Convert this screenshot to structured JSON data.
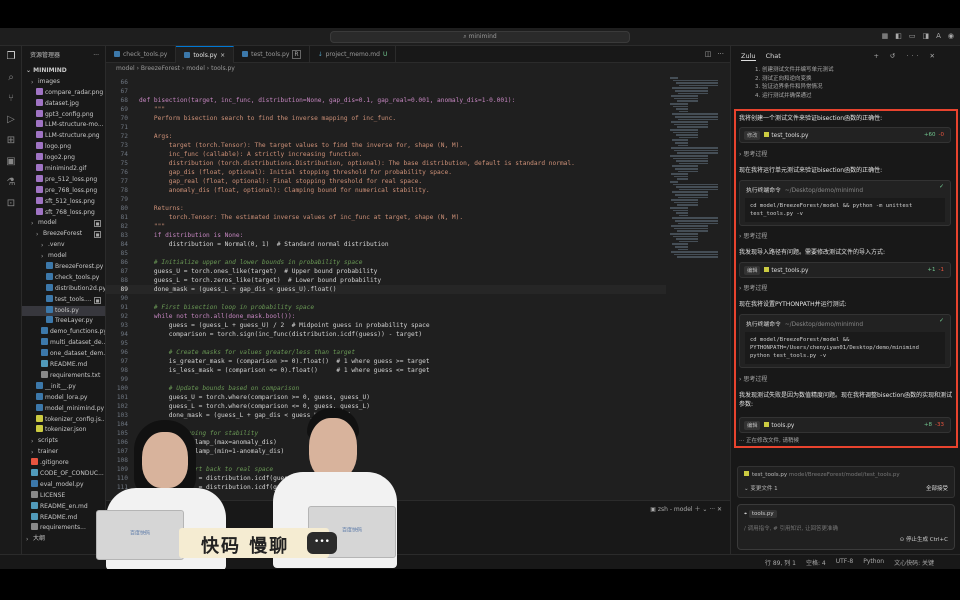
{
  "window": {
    "search_text": "minimind"
  },
  "sidebar": {
    "title": "资源管理器",
    "root": "MINIMIND",
    "rows": [
      {
        "label": "images",
        "kind": "folder"
      },
      {
        "label": "compare_radar.png",
        "kind": "img"
      },
      {
        "label": "dataset.jpg",
        "kind": "img"
      },
      {
        "label": "gpt3_config.png",
        "kind": "img"
      },
      {
        "label": "LLM-structure-mo...",
        "kind": "img"
      },
      {
        "label": "LLM-structure.png",
        "kind": "img"
      },
      {
        "label": "logo.png",
        "kind": "img"
      },
      {
        "label": "logo2.png",
        "kind": "img"
      },
      {
        "label": "minimind2.gif",
        "kind": "img"
      },
      {
        "label": "pre_512_loss.png",
        "kind": "img"
      },
      {
        "label": "pre_768_loss.png",
        "kind": "img"
      },
      {
        "label": "sft_512_loss.png",
        "kind": "img"
      },
      {
        "label": "sft_768_loss.png",
        "kind": "img"
      },
      {
        "label": "model",
        "kind": "folder"
      },
      {
        "label": "BreezeForest",
        "kind": "folder"
      },
      {
        "label": ".venv",
        "kind": "folder"
      },
      {
        "label": "model",
        "kind": "folder"
      },
      {
        "label": "BreezeForest.py",
        "kind": "py"
      },
      {
        "label": "check_tools.py",
        "kind": "py"
      },
      {
        "label": "distribution2d.py",
        "kind": "py"
      },
      {
        "label": "test_tools....",
        "kind": "py"
      },
      {
        "label": "tools.py",
        "kind": "py"
      },
      {
        "label": "TreeLayer.py",
        "kind": "py"
      },
      {
        "label": "demo_functions.py",
        "kind": "py"
      },
      {
        "label": "multi_dataset_de...",
        "kind": "py"
      },
      {
        "label": "one_dataset_dem...",
        "kind": "py"
      },
      {
        "label": "README.md",
        "kind": "md"
      },
      {
        "label": "requirements.txt",
        "kind": "txt"
      },
      {
        "label": "__init__.py",
        "kind": "py"
      },
      {
        "label": "model_lora.py",
        "kind": "py"
      },
      {
        "label": "model_minimind.py",
        "kind": "py"
      },
      {
        "label": "tokenizer_config.js...",
        "kind": "json"
      },
      {
        "label": "tokenizer.json",
        "kind": "json"
      },
      {
        "label": "scripts",
        "kind": "folder"
      },
      {
        "label": "trainer",
        "kind": "folder"
      },
      {
        "label": ".gitignore",
        "kind": "git"
      },
      {
        "label": "CODE_OF_CONDUC...",
        "kind": "md"
      },
      {
        "label": "eval_model.py",
        "kind": "py"
      },
      {
        "label": "LICENSE",
        "kind": "txt"
      },
      {
        "label": "README_en.md",
        "kind": "md"
      },
      {
        "label": "README.md",
        "kind": "md"
      },
      {
        "label": "requirements...",
        "kind": "txt"
      },
      {
        "label": "大纲",
        "kind": "folder"
      }
    ]
  },
  "tabs": [
    {
      "label": "check_tools.py",
      "flag": ""
    },
    {
      "label": "tools.py",
      "flag": "×"
    },
    {
      "label": "test_tools.py",
      "flag": "R"
    },
    {
      "label": "project_memo.md",
      "flag": "U"
    }
  ],
  "breadcrumb": "model  ›  BreezeForest  ›  model  ›  tools.py",
  "editor": {
    "current_line": 89,
    "lines": [
      {
        "n": "66",
        "t": "",
        "c": ""
      },
      {
        "n": "67",
        "t": "",
        "c": ""
      },
      {
        "n": "68",
        "t": "def bisection(target, inc_func, distribution=None, gap_dis=0.1, gap_real=0.001, anomaly_dis=1-0.001):",
        "c": "kw"
      },
      {
        "n": "69",
        "t": "    \"\"\"",
        "c": "doc"
      },
      {
        "n": "70",
        "t": "    Perform bisection search to find the inverse mapping of inc_func.",
        "c": "doc"
      },
      {
        "n": "71",
        "t": "",
        "c": ""
      },
      {
        "n": "72",
        "t": "    Args:",
        "c": "doc"
      },
      {
        "n": "73",
        "t": "        target (torch.Tensor): The target values to find the inverse for, shape (N, M).",
        "c": "doc"
      },
      {
        "n": "74",
        "t": "        inc_func (callable): A strictly increasing function.",
        "c": "doc"
      },
      {
        "n": "75",
        "t": "        distribution (torch.distributions.Distribution, optional): The base distribution, default is standard normal.",
        "c": "doc"
      },
      {
        "n": "76",
        "t": "        gap_dis (float, optional): Initial stopping threshold for probability space.",
        "c": "doc"
      },
      {
        "n": "77",
        "t": "        gap_real (float, optional): Final stopping threshold for real space.",
        "c": "doc"
      },
      {
        "n": "78",
        "t": "        anomaly_dis (float, optional): Clamping bound for numerical stability.",
        "c": "doc"
      },
      {
        "n": "79",
        "t": "",
        "c": ""
      },
      {
        "n": "80",
        "t": "    Returns:",
        "c": "doc"
      },
      {
        "n": "81",
        "t": "        torch.Tensor: The estimated inverse values of inc_func at target, shape (N, M).",
        "c": "doc"
      },
      {
        "n": "82",
        "t": "    \"\"\"",
        "c": "doc"
      },
      {
        "n": "83",
        "t": "    if distribution is None:",
        "c": "kw"
      },
      {
        "n": "84",
        "t": "        distribution = Normal(0, 1)  # Standard normal distribution",
        "c": ""
      },
      {
        "n": "85",
        "t": "",
        "c": ""
      },
      {
        "n": "86",
        "t": "    # Initialize upper and lower bounds in probability space",
        "c": "cmt"
      },
      {
        "n": "87",
        "t": "    guess_U = torch.ones_like(target)  # Upper bound probability",
        "c": ""
      },
      {
        "n": "88",
        "t": "    guess_L = torch.zeros_like(target)  # Lower bound probability",
        "c": ""
      },
      {
        "n": "89",
        "t": "    done_mask = (guess_L + gap_dis < guess_U).float()",
        "c": ""
      },
      {
        "n": "90",
        "t": "",
        "c": ""
      },
      {
        "n": "91",
        "t": "    # First bisection loop in probability space",
        "c": "cmt"
      },
      {
        "n": "92",
        "t": "    while not torch.all(done_mask.bool()):",
        "c": "kw"
      },
      {
        "n": "93",
        "t": "        guess = (guess_L + guess_U) / 2  # Midpoint guess in probability space",
        "c": ""
      },
      {
        "n": "94",
        "t": "        comparison = torch.sign(inc_func(distribution.icdf(guess)) - target)",
        "c": ""
      },
      {
        "n": "95",
        "t": "",
        "c": ""
      },
      {
        "n": "96",
        "t": "        # Create masks for values greater/less than target",
        "c": "cmt"
      },
      {
        "n": "97",
        "t": "        is_greater_mask = (comparison >= 0).float()  # 1 where guess >= target",
        "c": ""
      },
      {
        "n": "98",
        "t": "        is_less_mask = (comparison <= 0).float()     # 1 where guess <= target",
        "c": ""
      },
      {
        "n": "99",
        "t": "",
        "c": ""
      },
      {
        "n": "100",
        "t": "        # Update bounds based on comparison",
        "c": "cmt"
      },
      {
        "n": "101",
        "t": "        guess_U = torch.where(comparison >= 0, guess, guess_U)",
        "c": ""
      },
      {
        "n": "102",
        "t": "        guess_L = torch.where(comparison <= 0, guess, guess_L)",
        "c": ""
      },
      {
        "n": "103",
        "t": "        done_mask = (guess_L + gap_dis < guess_U).float()",
        "c": ""
      },
      {
        "n": "104",
        "t": "",
        "c": ""
      },
      {
        "n": "105",
        "t": "        # Clamping for stability",
        "c": "cmt"
      },
      {
        "n": "106",
        "t": "        guess.clamp_(max=anomaly_dis)",
        "c": ""
      },
      {
        "n": "107",
        "t": "        guess.clamp_(min=1-anomaly_dis)",
        "c": ""
      },
      {
        "n": "108",
        "t": "",
        "c": ""
      },
      {
        "n": "109",
        "t": "        # Convert back to real space",
        "c": "cmt"
      },
      {
        "n": "110",
        "t": "        guess_U = distribution.icdf(guess_U)",
        "c": ""
      },
      {
        "n": "111",
        "t": "        guess_L = distribution.icdf(guess_L)",
        "c": ""
      }
    ]
  },
  "terminal": {
    "label": "zsh - model"
  },
  "chat": {
    "tabs": [
      "Zulu",
      "Chat"
    ],
    "steps": [
      "1. 创建测试文件并编写单元测试",
      "2. 测试正向和逆向变换",
      "3. 验证边界条件和异常情况",
      "4. 运行测试并确保通过"
    ],
    "msg1": "我将创建一个测试文件来验证bisection函数的正确性:",
    "card1": {
      "chip": "修改",
      "file": "test_tools.py",
      "plus": "+60",
      "minus": "-0"
    },
    "think": "思考过程",
    "msg2": "现在我将运行单元测试来验证bisection函数的正确性:",
    "cmd1": {
      "title": "执行终端命令",
      "path": "~/Desktop/demo/minimind",
      "code": "cd model/BreezeForest/model && python -m unittest test_tools.py -v"
    },
    "msg3": "我发现导入路径有问题。需要修改测试文件的导入方式:",
    "card2": {
      "chip": "编辑",
      "file": "test_tools.py",
      "plus": "+1",
      "minus": "-1"
    },
    "msg4": "现在我将设置PYTHONPATH并运行测试:",
    "cmd2": {
      "title": "执行终端命令",
      "path": "~/Desktop/demo/minimind",
      "code": "cd model/BreezeForest/model && PYTHONPATH=/Users/chenyiyan01/Desktop/demo/minimind python test_tools.py -v"
    },
    "msg5": "我发现测试失败是因为数值精度问题。现在我将调整bisection函数的实现和测试参数:",
    "card3": {
      "chip": "编辑",
      "file": "tools.py",
      "plus": "+8",
      "minus": "-33"
    },
    "busy": "正在修改文件, 请稍候",
    "pending_file": "test_tools.py",
    "pending_path": "model/BreezeForest/model/test_tools.py",
    "changes": "变更文件 1",
    "accept_all": "全部接受",
    "input_file": "tools.py",
    "input_placeholder": "/ 调用指令, # 引用知识, 让回答更准确",
    "stop": "停止生成 Ctrl+C"
  },
  "status": {
    "pos": "行 89, 列 1",
    "spaces": "空格: 4",
    "enc": "UTF-8",
    "lang": "Python",
    "ai": "文心快码: 关键"
  },
  "overlay": {
    "banner": "快码 慢聊",
    "bubble": "•••",
    "laptop_logo": "百度快码"
  }
}
